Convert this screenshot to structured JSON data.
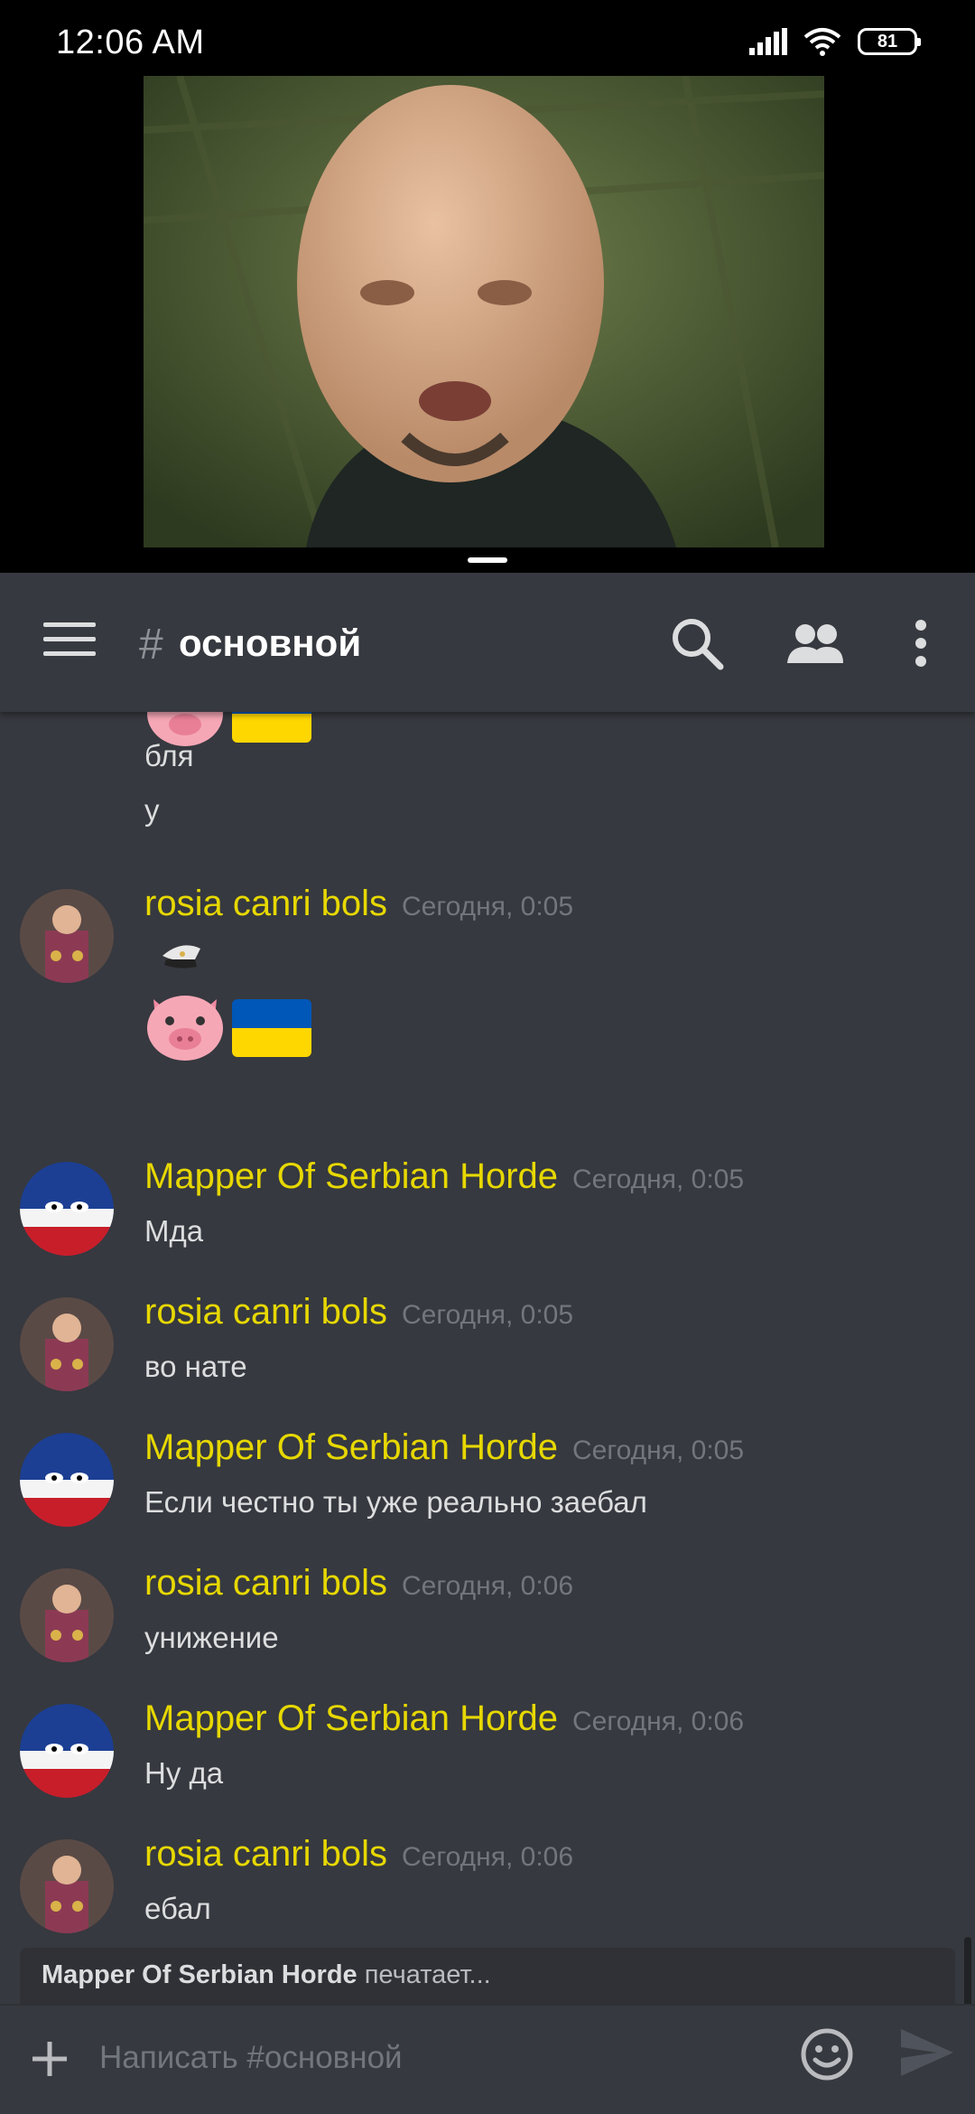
{
  "status_bar": {
    "time": "12:06  AM",
    "battery": "81"
  },
  "channel": {
    "hash": "#",
    "name": "основной"
  },
  "messages": {
    "cont1": "бля",
    "cont2": "у",
    "m1": {
      "user": "rosia canri bols",
      "time": "Сегодня, 0:05"
    },
    "m2": {
      "user": "Mapper Of Serbian Horde",
      "time": "Сегодня, 0:05",
      "text": "Мда"
    },
    "m3": {
      "user": "rosia canri bols",
      "time": "Сегодня, 0:05",
      "text": "во нате"
    },
    "m4": {
      "user": "Mapper Of Serbian Horde",
      "time": "Сегодня, 0:05",
      "text": "Если честно ты уже реально заебал"
    },
    "m5": {
      "user": "rosia canri bols",
      "time": "Сегодня, 0:06",
      "text": "унижение"
    },
    "m6": {
      "user": "Mapper Of Serbian Horde",
      "time": "Сегодня, 0:06",
      "text": "Ну да"
    },
    "m7": {
      "user": "rosia canri bols",
      "time": "Сегодня, 0:06",
      "text": "ебал"
    }
  },
  "typing": {
    "user": "Mapper Of Serbian Horde",
    "suffix": " печатает..."
  },
  "input": {
    "placeholder": "Написать #основной"
  },
  "colors": {
    "username": "#e7d800",
    "background": "#36393f",
    "timestamp": "#72767d"
  },
  "icons": [
    "signal-icon",
    "wifi-icon",
    "battery-icon",
    "menu-icon",
    "search-icon",
    "members-icon",
    "more-icon",
    "plus-icon",
    "emoji-icon",
    "send-icon",
    "pig-emoji",
    "ukraine-flag-emoji",
    "cap-emoji"
  ]
}
